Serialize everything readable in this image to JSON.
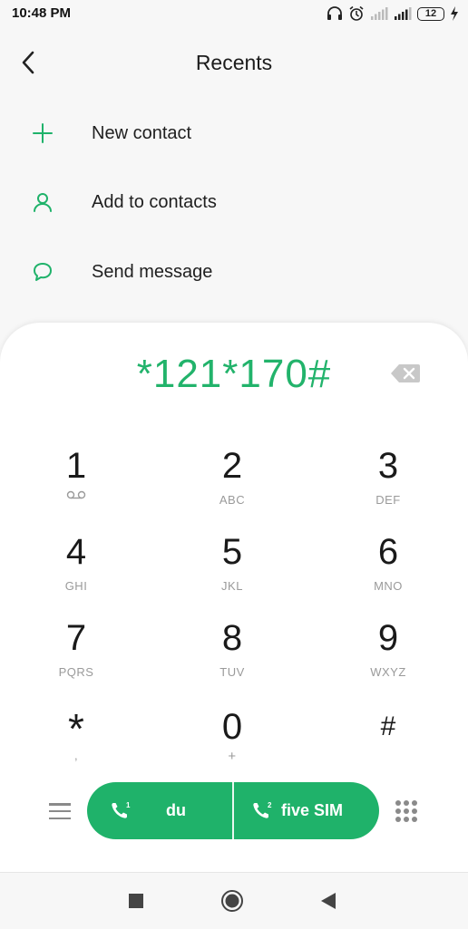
{
  "status": {
    "time": "10:48 PM",
    "battery": "12",
    "icons": [
      "headphones-icon",
      "alarm-icon",
      "signal-icon",
      "signal-icon",
      "battery-icon",
      "charging-icon"
    ]
  },
  "header": {
    "title": "Recents",
    "back_icon": "chevron-left-icon"
  },
  "actions": [
    {
      "label": "New contact",
      "icon": "plus-icon"
    },
    {
      "label": "Add to contacts",
      "icon": "person-icon"
    },
    {
      "label": "Send message",
      "icon": "chat-bubble-icon"
    }
  ],
  "dialer": {
    "number": "*121*170#",
    "keys": [
      {
        "digit": "1",
        "sub": "voicemail"
      },
      {
        "digit": "2",
        "sub": "ABC"
      },
      {
        "digit": "3",
        "sub": "DEF"
      },
      {
        "digit": "4",
        "sub": "GHI"
      },
      {
        "digit": "5",
        "sub": "JKL"
      },
      {
        "digit": "6",
        "sub": "MNO"
      },
      {
        "digit": "7",
        "sub": "PQRS"
      },
      {
        "digit": "8",
        "sub": "TUV"
      },
      {
        "digit": "9",
        "sub": "WXYZ"
      },
      {
        "digit": "*",
        "sub": ","
      },
      {
        "digit": "0",
        "sub": "+"
      },
      {
        "digit": "#",
        "sub": ""
      }
    ]
  },
  "call_bar": {
    "sim1": {
      "label": "du",
      "slot": "1"
    },
    "sim2": {
      "label": "five SIM",
      "slot": "2"
    }
  },
  "colors": {
    "accent": "#1fb26a",
    "number": "#22b36b"
  }
}
